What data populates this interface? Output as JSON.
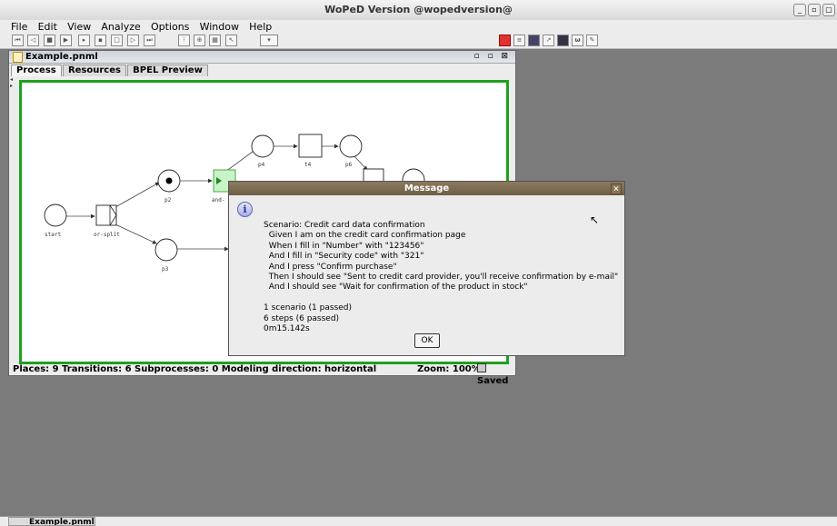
{
  "window": {
    "title": "WoPeD Version @wopedversion@",
    "controls": [
      "_",
      "▫",
      "▢"
    ]
  },
  "menu": [
    "File",
    "Edit",
    "View",
    "Analyze",
    "Options",
    "Window",
    "Help"
  ],
  "internal_frame": {
    "title": "Example.pnml",
    "controls": "▫ ▫ ⊠",
    "tabs": [
      "Process",
      "Resources",
      "BPEL Preview"
    ],
    "status": {
      "left": "Places: 9  Transitions: 6  Subprocesses: 0  Modeling direction: horizontal",
      "zoom": "Zoom: 100%",
      "saved": "Saved"
    }
  },
  "petri": {
    "start": "start",
    "or_split": "or-split",
    "p2": "p2",
    "p3": "p3",
    "and": "and-",
    "p4": "p4",
    "t4": "t4",
    "p6": "p6"
  },
  "dialog": {
    "title": "Message",
    "close": "×",
    "message": "Scenario: Credit card data confirmation\n  Given I am on the credit card confirmation page\n  When I fill in \"Number\" with \"123456\"\n  And I fill in \"Security code\" with \"321\"\n  And I press \"Confirm purchase\"\n  Then I should see \"Sent to credit card provider, you'll receive confirmation by e-mail\"\n  And I should see \"Wait for confirmation of the product in stock\"\n\n1 scenario (1 passed)\n6 steps (6 passed)\n0m15.142s",
    "ok": "OK"
  },
  "taskbar": {
    "item": "Example.pnml"
  },
  "colors": {
    "canvas_border": "#1ea01e",
    "dialog_title": "#7a6a50",
    "desktop": "#7b7b7b"
  }
}
